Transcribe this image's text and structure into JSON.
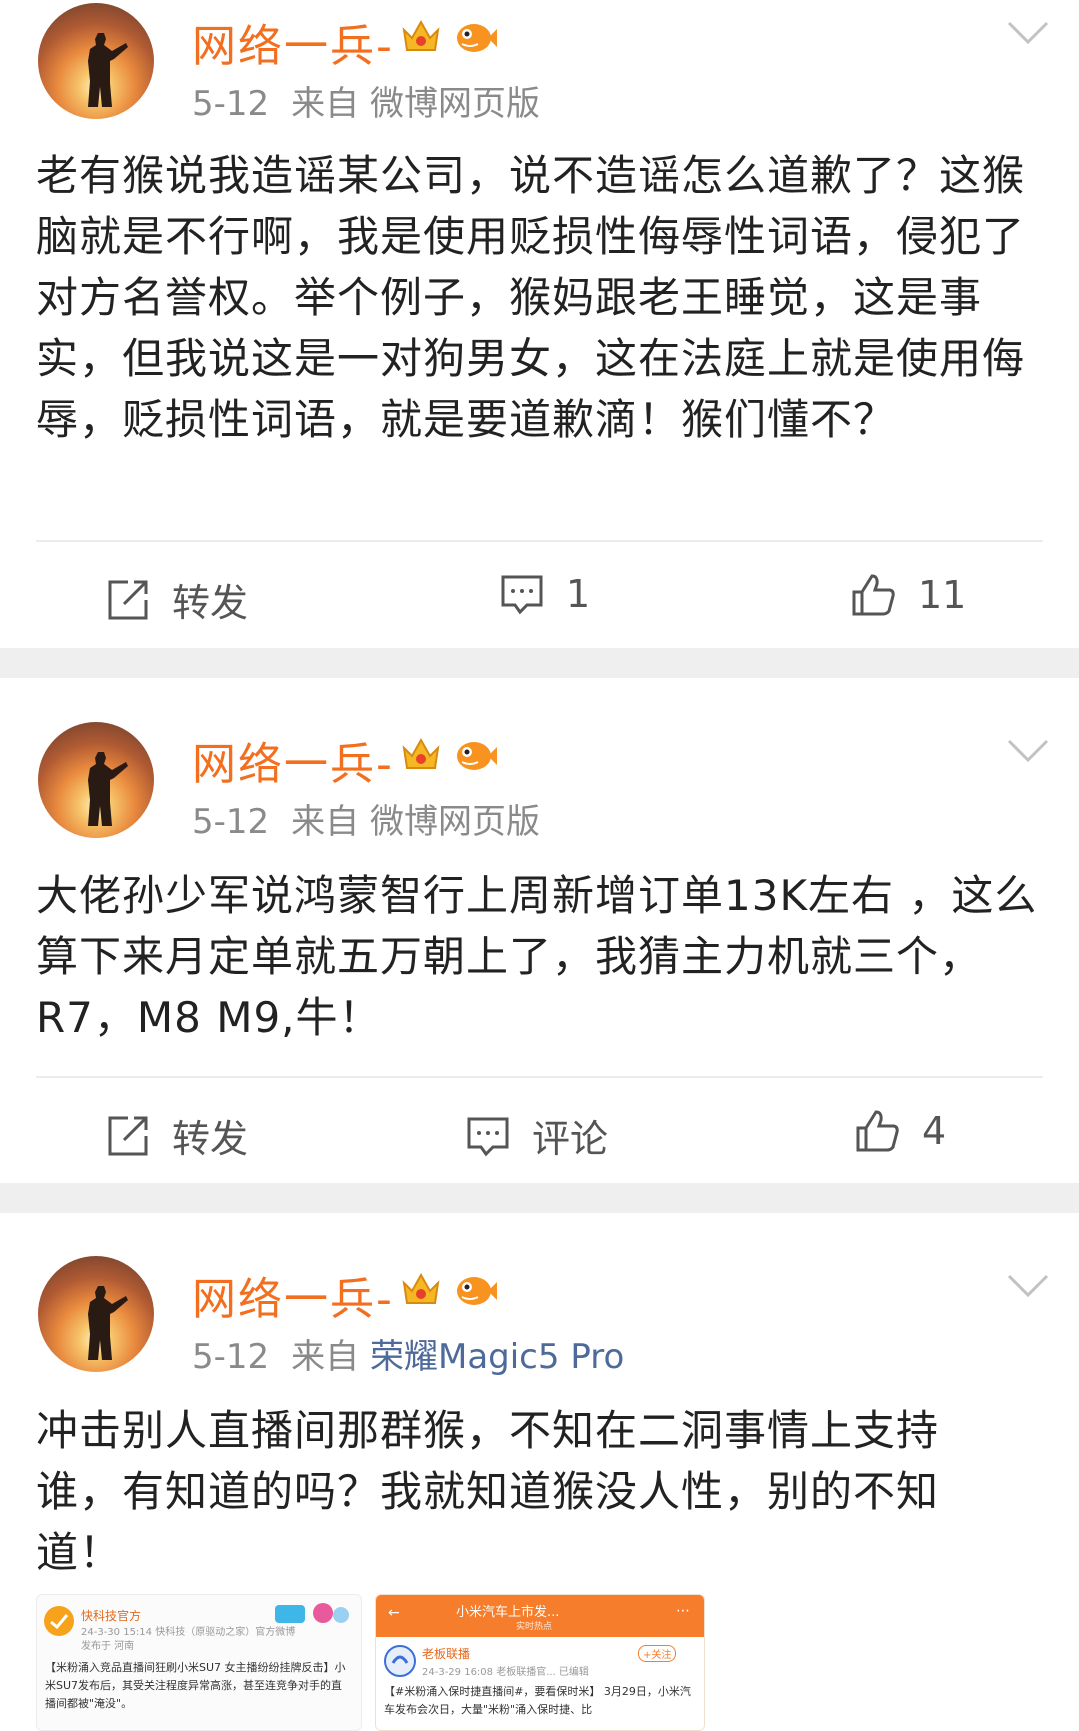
{
  "posts": [
    {
      "username": "网络一兵-",
      "date": "5-12",
      "source_prefix": "来自",
      "source": "微博网页版",
      "content": "老有猴说我造谣某公司，说不造谣怎么道歉了？这猴脑就是不行啊，我是使用贬损性侮辱性词语，侵犯了对方名誉权。举个例子，猴妈跟老王睡觉，这是事实，但我说这是一对狗男女，这在法庭上就是使用侮辱，贬损性词语，就是要道歉滴！猴们懂不？",
      "actions": {
        "repost": "转发",
        "comment": "1",
        "like": "11"
      }
    },
    {
      "username": "网络一兵-",
      "date": "5-12",
      "source_prefix": "来自",
      "source": "微博网页版",
      "content": "大佬孙少军说鸿蒙智行上周新增订单13K左右 ，这么算下来月定单就五万朝上了，我猜主力机就三个，R7，M8 M9,牛！",
      "actions": {
        "repost": "转发",
        "comment": "评论",
        "like": "4"
      }
    },
    {
      "username": "网络一兵-",
      "date": "5-12",
      "source_prefix": "来自",
      "source": "荣耀Magic5 Pro",
      "content": "冲击别人直播间那群猴，不知在二洞事情上支持谁，有知道的吗？我就知道猴没人性，别的不知道！",
      "thumbnails": [
        {
          "account": "快科技官方",
          "meta": "24-3-30 15:14  快科技（原驱动之家）官方微博",
          "meta2": "发布于 河南",
          "body": "【米粉涌入竞品直播间狂刷小米SU7 女主播纷纷挂牌反击】小米SU7发布后，其受关注程度异常高涨，甚至连竞争对手的直播间都被\"淹没\"。"
        },
        {
          "header": "小米汽车上市发...",
          "header_sub": "实时热点",
          "account": "老板联播",
          "follow": "+关注",
          "meta": "24-3-29 16:08  老板联播官... 已编辑",
          "body": "【#米粉涌入保时捷直播间#，要看保时米】 3月29日，小米汽车发布会次日，大量\"米粉\"涌入保时捷、比"
        }
      ]
    }
  ],
  "colors": {
    "username": "#f36f20",
    "link": "#4d6a9a",
    "separator": "#efefef"
  },
  "icons": [
    "chevron-down-icon",
    "repost-icon",
    "comment-icon",
    "like-icon",
    "vip-crown-icon",
    "fish-badge-icon"
  ]
}
